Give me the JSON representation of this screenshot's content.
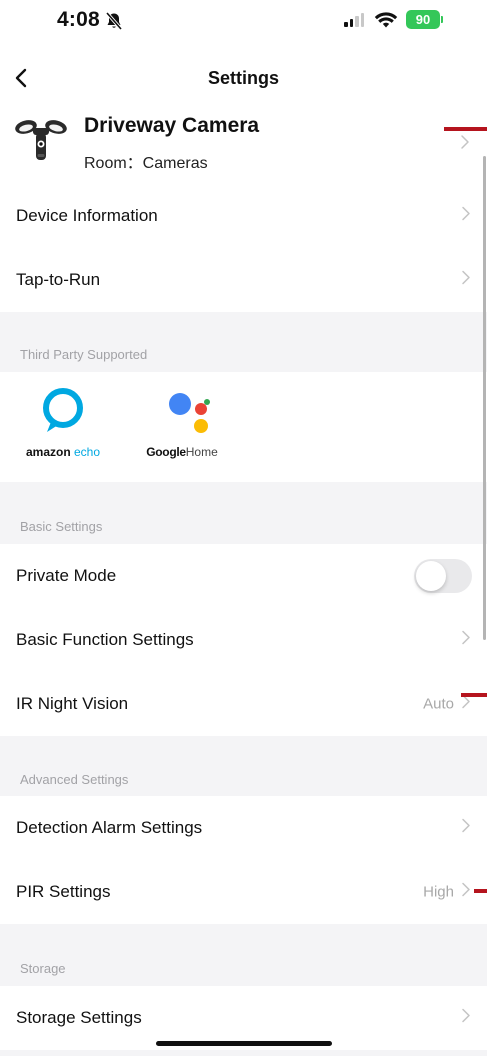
{
  "status_bar": {
    "time": "4:08",
    "battery": "90"
  },
  "nav": {
    "title": "Settings"
  },
  "device": {
    "name": "Driveway Camera",
    "room": "Room：Cameras"
  },
  "rows": {
    "device_information": "Device Information",
    "tap_to_run": "Tap-to-Run",
    "private_mode": "Private Mode",
    "basic_function_settings": "Basic Function Settings",
    "ir_night_vision": "IR Night Vision",
    "ir_night_vision_value": "Auto",
    "detection_alarm_settings": "Detection Alarm Settings",
    "pir_settings": "PIR Settings",
    "pir_settings_value": "High",
    "storage_settings": "Storage Settings"
  },
  "sections": {
    "third_party": "Third Party Supported",
    "basic": "Basic Settings",
    "advanced": "Advanced Settings",
    "storage": "Storage"
  },
  "third_party": {
    "echo_brand": "amazon",
    "echo_product": "echo",
    "google_brand": "Google",
    "google_product": "Home"
  },
  "toggles": {
    "private_mode_on": false
  },
  "colors": {
    "background": "#ffffff",
    "section_background": "#f4f4f6",
    "secondary_text": "#a2a2a6",
    "battery": "#34c759",
    "alexa_blue": "#00a8e1",
    "google_blue": "#4285f4",
    "google_red": "#ea4335",
    "google_yellow": "#fbbc05",
    "google_green": "#34a853",
    "marker_red": "#b5141e"
  },
  "icons": {
    "back": "chevron-left-icon",
    "row_arrow": "chevron-right-icon",
    "mute": "bell-slash-icon",
    "device": "floodlight-camera-icon"
  }
}
